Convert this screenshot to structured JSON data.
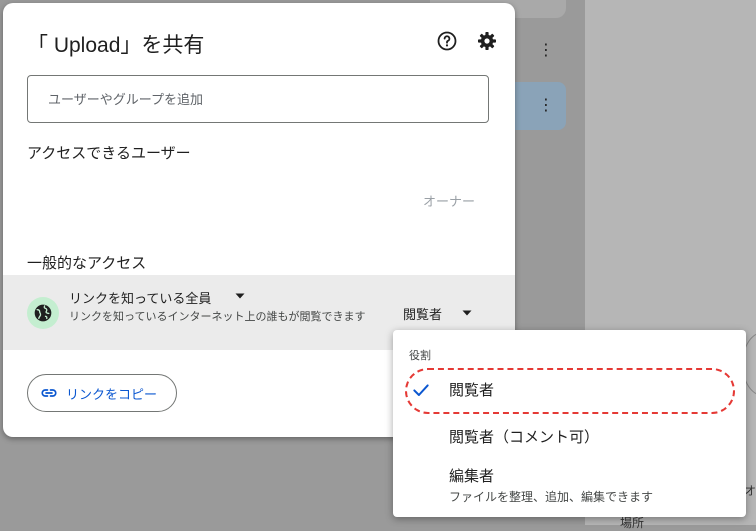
{
  "dialog": {
    "title": "「 Upload」を共有",
    "help_icon": "help-circle-icon",
    "settings_icon": "gear-icon",
    "add_input": {
      "placeholder": "ユーザーやグループを追加",
      "value": ""
    },
    "people_heading": "アクセスできるユーザー",
    "owner_label": "オーナー",
    "general_heading": "一般的なアクセス",
    "access": {
      "icon": "globe-icon",
      "title": "リンクを知っている全員",
      "description": "リンクを知っているインターネット上の誰もが閲覧できます",
      "role": "閲覧者"
    },
    "copy_link_label": "リンクをコピー"
  },
  "role_menu": {
    "header": "役割",
    "items": [
      {
        "label": "閲覧者",
        "selected": true
      },
      {
        "label": "閲覧者（コメント可）",
        "selected": false
      },
      {
        "label": "編集者",
        "sublabel": "ファイルを整理、追加、編集できます",
        "selected": false
      }
    ]
  },
  "background": {
    "text_o": "オ",
    "text_place": "場所"
  },
  "colors": {
    "link_blue": "#0b57d0",
    "globe_bg": "#c4eed0",
    "highlight_red": "#e53935"
  }
}
